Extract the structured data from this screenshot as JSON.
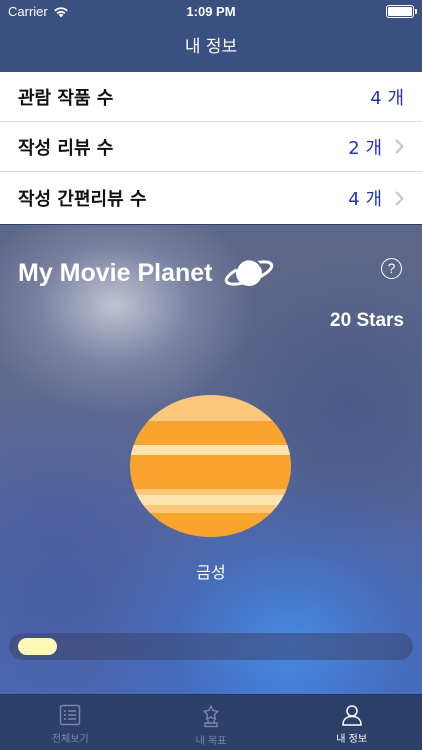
{
  "status_bar": {
    "carrier": "Carrier",
    "time": "1:09 PM"
  },
  "nav": {
    "title": "내 정보"
  },
  "stats": [
    {
      "label": "관람 작품 수",
      "value": "4 개",
      "has_chevron": false
    },
    {
      "label": "작성 리뷰 수",
      "value": "2 개",
      "has_chevron": true
    },
    {
      "label": "작성 간편리뷰 수",
      "value": "4 개",
      "has_chevron": true
    }
  ],
  "planet_section": {
    "title": "My Movie Planet",
    "help_icon": "?",
    "stars": "20 Stars",
    "planet_name": "금성",
    "progress_fraction": 0.1
  },
  "tabs": [
    {
      "label": "전체보기",
      "icon": "list-icon",
      "active": false
    },
    {
      "label": "내 목표",
      "icon": "trophy-icon",
      "active": false
    },
    {
      "label": "내 정보",
      "icon": "person-icon",
      "active": true
    }
  ],
  "colors": {
    "bar_bg": "#3a5080",
    "stat_value": "#2234b8",
    "planet_orange": "#f9a52d",
    "planet_stripe": "#fde3b0",
    "progress_fill": "#fdf8b5"
  }
}
